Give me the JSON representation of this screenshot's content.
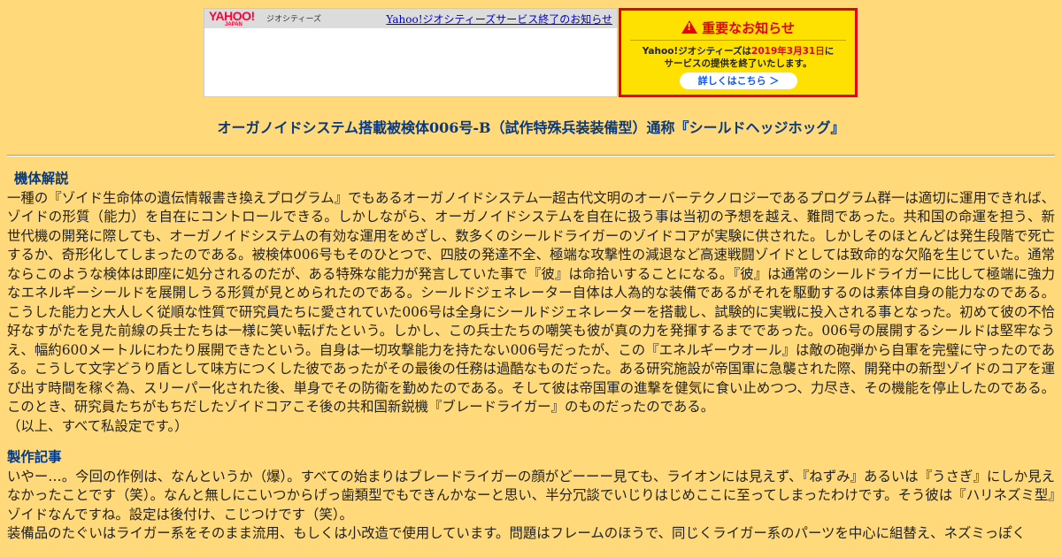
{
  "banner": {
    "yahoo_logo": "YAHOO!",
    "yahoo_logo_sub": "JAPAN",
    "geo_label": "ジオシティーズ",
    "end_link": "Yahoo!ジオシティーズサービス終了のお知らせ"
  },
  "notice": {
    "title": "重要なお知らせ",
    "line1_pre": "Yahoo!ジオシティーズは",
    "line1_date": "2019年3月31日",
    "line1_post": "に",
    "line2": "サービスの提供を終了いたします。",
    "button": "詳しくはこちら ＞"
  },
  "page_title": "オーガノイドシステム搭載被検体006号-B（試作特殊兵装装備型）通称『シールドヘッジホッグ』",
  "sections": {
    "spec_heading": "機体解説",
    "spec_body": "一種の『ゾイド生命体の遺伝情報書き換えプログラム』でもあるオーガノイドシステム一超古代文明のオーバーテクノロジーであるプログラム群一は適切に運用できれば、ゾイドの形質（能力）を自在にコントロールできる。しかしながら、オーガノイドシステムを自在に扱う事は当初の予想を越え、難問であった。共和国の命運を担う、新世代機の開発に際しても、オーガノイドシステムの有効な運用をめざし、数多くのシールドライガーのゾイドコアが実験に供された。しかしそのほとんどは発生段階で死亡するか、奇形化してしまったのである。被検体006号もそのひとつで、四肢の発達不全、極端な攻撃性の減退など高速戦闘ゾイドとしては致命的な欠陥を生じていた。通常ならこのような検体は即座に処分されるのだが、ある特殊な能力が発言していた事で『彼』は命拾いすることになる。『彼』は通常のシールドライガーに比して極端に強力なエネルギーシールドを展開しうる形質が見とめられたのである。シールドジェネレーター自体は人為的な装備であるがそれを駆動するのは素体自身の能力なのである。こうした能力と大人しく従順な性質で研究員たちに愛されていた006号は全身にシールドジェネレーターを搭載し、試験的に実戦に投入される事となった。初めて彼の不恰好なすがたを見た前線の兵士たちは一様に笑い転げたという。しかし、この兵士たちの嘲笑も彼が真の力を発揮するまでであった。006号の展開するシールドは堅牢なうえ、幅約600メートルにわたり展開できたという。自身は一切攻撃能力を持たない006号だったが、この『エネルギーウオール』は敵の砲弾から自軍を完璧に守ったのである。こうして文字どうり盾として味方につくした彼であったがその最後の任務は過酷なものだった。ある研究施設が帝国軍に急襲された際、開発中の新型ゾイドのコアを運び出す時間を稼ぐ為、スリーパー化された後、単身でその防衛を勤めたのである。そして彼は帝国軍の進撃を健気に食い止めつつ、力尽き、その機能を停止したのである。このとき、研究員たちがもちだしたゾイドコアこそ後の共和国新鋭機『ブレードライガー』のものだったのである。",
    "spec_note": "（以上、すべて私設定です。）",
    "making_heading": "製作記事",
    "making_body1": "いやー…。今回の作例は、なんというか（爆）。すべての始まりはブレードライガーの顔がどーーー見ても、ライオンには見えず、『ねずみ』あるいは『うさぎ』にしか見えなかったことです（笑）。なんと無しにこいつからげっ歯類型でもできんかなーと思い、半分冗談でいじりはじめここに至ってしまったわけです。そう彼は『ハリネズミ型』ゾイドなんですね。設定は後付け、こじつけです（笑）。",
    "making_body2": "装備品のたぐいはライガー系をそのまま流用、もしくは小改造で使用しています。問題はフレームのほうで、同じくライガー系のパーツを中心に組替え、ネズミっぽく"
  },
  "colors": {
    "background": "#ffd97a",
    "heading": "#0b3a7a",
    "notice_red": "#e60012",
    "notice_yellow": "#ffe100",
    "link": "#0000cc"
  }
}
